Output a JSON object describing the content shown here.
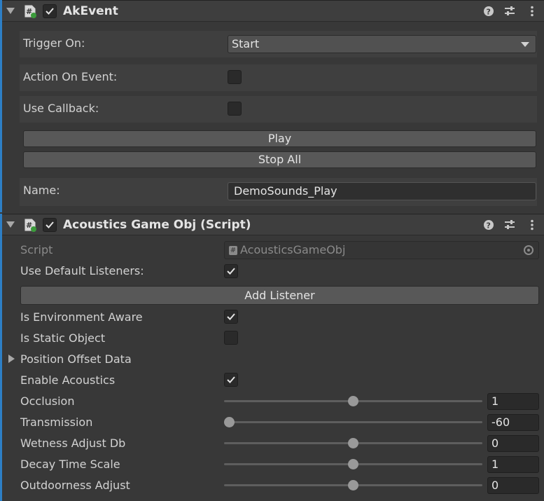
{
  "colors": {
    "accent": "#2d7fc6",
    "background": "#383838",
    "header": "#3e3e3e"
  },
  "ak_event": {
    "title": "AkEvent",
    "enabled": true,
    "trigger_on_label": "Trigger On:",
    "trigger_on_value": "Start",
    "action_on_event_label": "Action On Event:",
    "action_on_event_checked": false,
    "use_callback_label": "Use Callback:",
    "use_callback_checked": false,
    "play_label": "Play",
    "stop_all_label": "Stop All",
    "name_label": "Name:",
    "name_value": "DemoSounds_Play"
  },
  "acoustics": {
    "title": "Acoustics Game Obj (Script)",
    "enabled": true,
    "script_label": "Script",
    "script_value": "AcousticsGameObj",
    "use_default_listeners_label": "Use Default Listeners:",
    "use_default_listeners_checked": true,
    "add_listener_label": "Add Listener",
    "is_environment_aware_label": "Is Environment Aware",
    "is_environment_aware_checked": true,
    "is_static_object_label": "Is Static Object",
    "is_static_object_checked": false,
    "position_offset_label": "Position Offset Data",
    "enable_acoustics_label": "Enable Acoustics",
    "enable_acoustics_checked": true,
    "sliders": [
      {
        "label": "Occlusion",
        "value": "1",
        "fraction": 0.5
      },
      {
        "label": "Transmission",
        "value": "-60",
        "fraction": 0.0
      },
      {
        "label": "Wetness Adjust Db",
        "value": "0",
        "fraction": 0.5
      },
      {
        "label": "Decay Time Scale",
        "value": "1",
        "fraction": 0.5
      },
      {
        "label": "Outdoorness Adjust",
        "value": "0",
        "fraction": 0.5
      }
    ]
  },
  "icons": {
    "fold": "fold-down-arrow-icon",
    "script": "csharp-script-icon",
    "help": "help-icon",
    "presets": "sliders-icon",
    "menu": "kebab-menu-icon",
    "check": "checkmark-icon"
  }
}
